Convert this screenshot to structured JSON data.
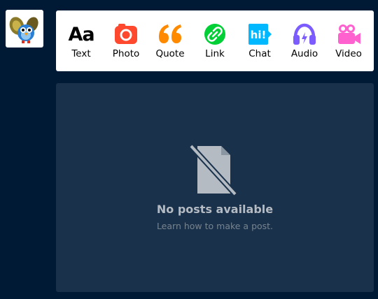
{
  "composer": {
    "post_types": [
      {
        "label": "Text",
        "icon": "text-icon",
        "glyph": "Aa",
        "color": "#000000"
      },
      {
        "label": "Photo",
        "icon": "camera-icon",
        "color": "#ff492f"
      },
      {
        "label": "Quote",
        "icon": "quote-icon",
        "color": "#ff8a00"
      },
      {
        "label": "Link",
        "icon": "link-icon",
        "color": "#00cf35"
      },
      {
        "label": "Chat",
        "icon": "chat-icon",
        "glyph": "hi!",
        "color": "#00b8ff"
      },
      {
        "label": "Audio",
        "icon": "headphones-icon",
        "color": "#7c5cff"
      },
      {
        "label": "Video",
        "icon": "video-camera-icon",
        "color": "#ff62ce"
      }
    ]
  },
  "empty_state": {
    "icon": "no-document-icon",
    "title": "No posts available",
    "link": "Learn how to make a post."
  },
  "colors": {
    "background": "#001935",
    "panel": "#1a314b",
    "card": "#ffffff"
  }
}
